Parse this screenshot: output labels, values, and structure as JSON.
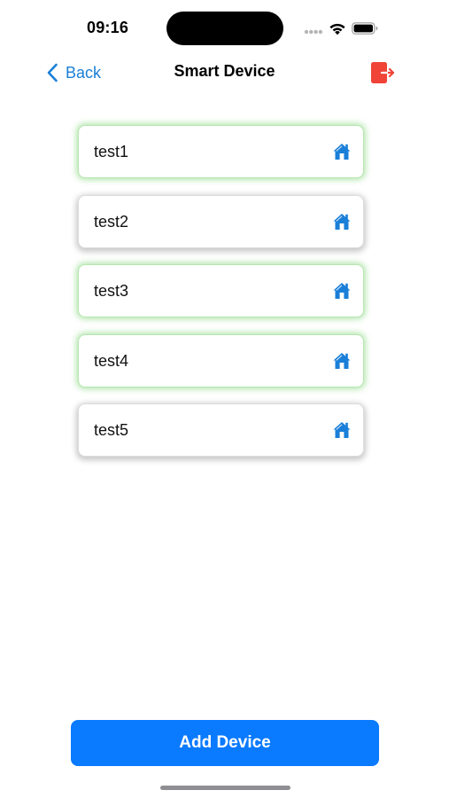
{
  "status_bar": {
    "time": "09:16"
  },
  "nav": {
    "back_label": "Back",
    "title": "Smart Device",
    "back_icon": "chevron-left-icon",
    "logout_icon": "logout-icon"
  },
  "devices": [
    {
      "name": "test1",
      "status": "online",
      "icon": "home-icon"
    },
    {
      "name": "test2",
      "status": "offline",
      "icon": "home-icon"
    },
    {
      "name": "test3",
      "status": "online",
      "icon": "home-icon"
    },
    {
      "name": "test4",
      "status": "online",
      "icon": "home-icon"
    },
    {
      "name": "test5",
      "status": "offline",
      "icon": "home-icon"
    }
  ],
  "add_device_label": "Add Device",
  "colors": {
    "accent": "#0a7aff",
    "back_link": "#1a7fd8",
    "logout": "#f04438",
    "online_glow": "#8ed884",
    "home_icon": "#1a7fd8"
  }
}
